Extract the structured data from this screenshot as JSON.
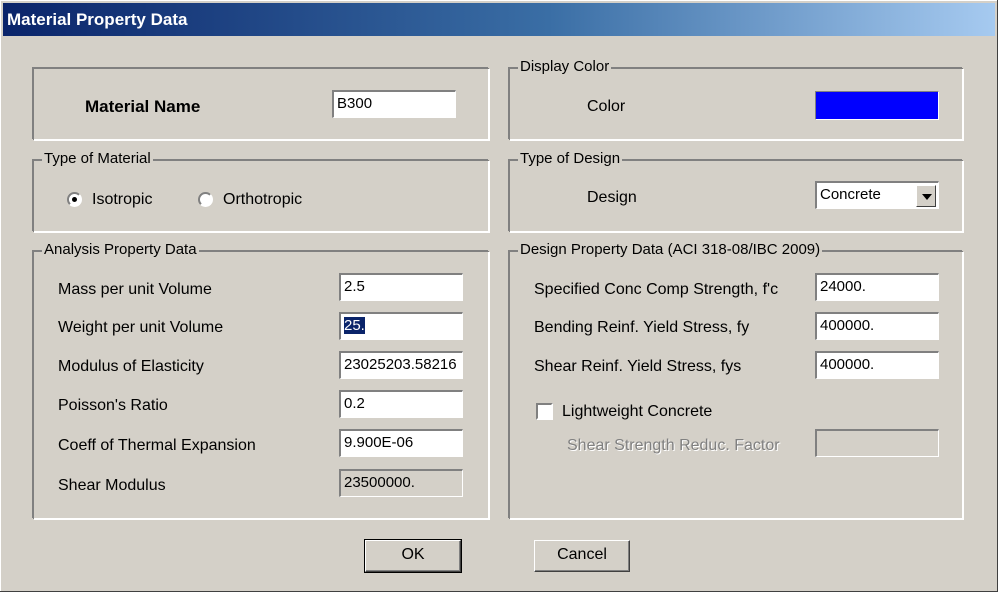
{
  "window": {
    "title": "Material Property Data"
  },
  "material_name": {
    "label": "Material Name",
    "value": "B300"
  },
  "display_color": {
    "legend": "Display Color",
    "label": "Color",
    "color": "#0000ff"
  },
  "type_of_material": {
    "legend": "Type of Material",
    "options": [
      {
        "label": "Isotropic",
        "selected": true
      },
      {
        "label": "Orthotropic",
        "selected": false
      }
    ]
  },
  "type_of_design": {
    "legend": "Type of Design",
    "label": "Design",
    "value": "Concrete"
  },
  "analysis": {
    "legend": "Analysis Property Data",
    "rows": [
      {
        "label": "Mass per unit Volume",
        "value": "2.5"
      },
      {
        "label": "Weight per unit Volume",
        "value": "25."
      },
      {
        "label": "Modulus of Elasticity",
        "value": "23025203.58216"
      },
      {
        "label": "Poisson's Ratio",
        "value": "0.2"
      },
      {
        "label": "Coeff of Thermal Expansion",
        "value": "9.900E-06"
      },
      {
        "label": "Shear Modulus",
        "value": "23500000."
      }
    ]
  },
  "design": {
    "legend": "Design Property Data (ACI 318-08/IBC 2009)",
    "rows": [
      {
        "label": "Specified Conc Comp Strength, f'c",
        "value": "24000."
      },
      {
        "label": "Bending Reinf. Yield Stress, fy",
        "value": "400000."
      },
      {
        "label": "Shear Reinf. Yield Stress, fys",
        "value": "400000."
      }
    ],
    "lightweight_label": "Lightweight Concrete",
    "lightweight_checked": false,
    "shear_reduc_label": "Shear Strength Reduc. Factor",
    "shear_reduc_value": ""
  },
  "buttons": {
    "ok": "OK",
    "cancel": "Cancel"
  }
}
